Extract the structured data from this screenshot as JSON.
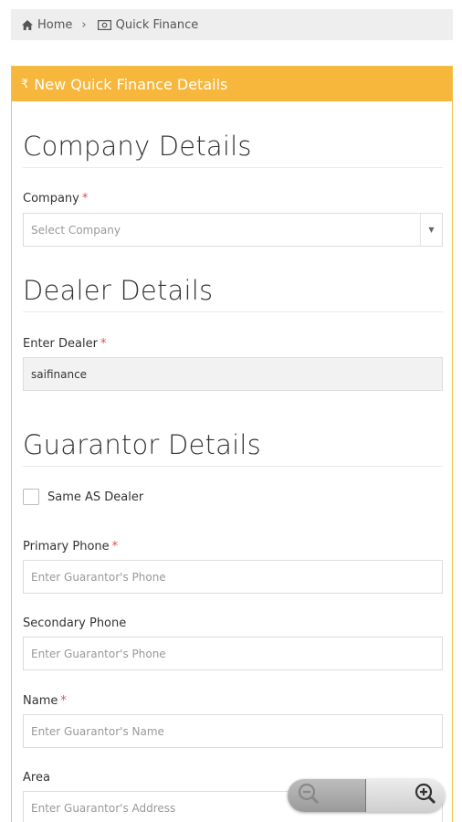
{
  "breadcrumb": {
    "home_label": "Home",
    "separator": "›",
    "current_label": "Quick Finance"
  },
  "panel": {
    "header_icon": "₹",
    "header_title": "New Quick Finance Details"
  },
  "company_section": {
    "title": "Company Details",
    "company_label": "Company",
    "company_placeholder": "Select Company",
    "caret": "▼"
  },
  "dealer_section": {
    "title": "Dealer Details",
    "dealer_label": "Enter Dealer",
    "dealer_value": "saifinance"
  },
  "guarantor_section": {
    "title": "Guarantor Details",
    "same_as_dealer_label": "Same AS Dealer",
    "primary_phone_label": "Primary Phone",
    "primary_phone_placeholder": "Enter Guarantor's Phone",
    "secondary_phone_label": "Secondary Phone",
    "secondary_phone_placeholder": "Enter Guarantor's Phone",
    "name_label": "Name",
    "name_placeholder": "Enter Guarantor's Name",
    "area_label": "Area",
    "area_placeholder": "Enter Guarantor's Address"
  },
  "required_marker": "*",
  "colors": {
    "accent": "#f6b73c",
    "required": "#d9534f"
  },
  "icons": [
    "home-icon",
    "money-icon",
    "rupee-icon",
    "zoom-out-icon",
    "zoom-in-icon"
  ]
}
